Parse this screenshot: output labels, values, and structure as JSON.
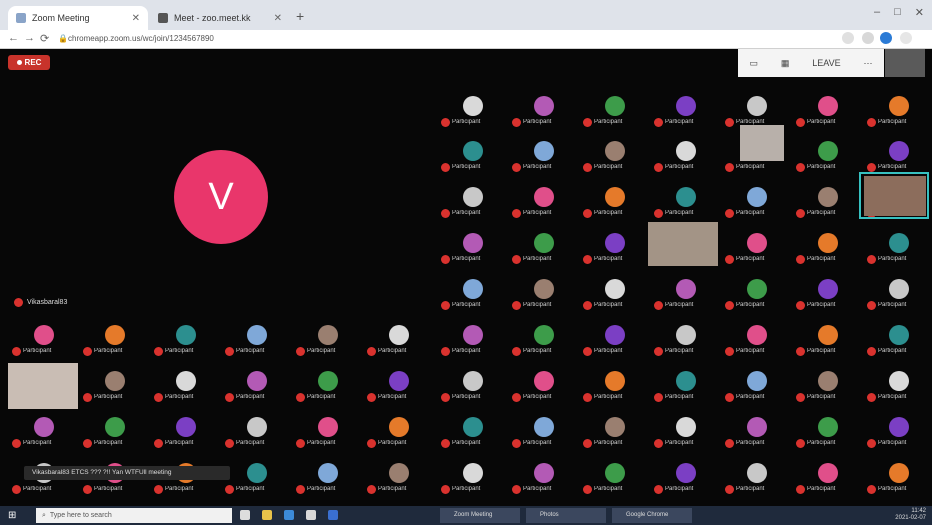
{
  "browser": {
    "tabs": [
      {
        "title": "Zoom Meeting",
        "active": true
      },
      {
        "title": "Meet - zoo.meet.kk",
        "active": false
      }
    ],
    "new_tab": "+",
    "url": "chromeapp.zoom.us/wc/join/1234567890",
    "back": "←",
    "forward": "→",
    "reload": "⟳",
    "window": {
      "minimize": "–",
      "maximize": "□",
      "close": "✕"
    }
  },
  "meeting": {
    "rec_label": "REC",
    "top_controls": {
      "view": "▭",
      "gallery": "▦",
      "leave": "LEAVE",
      "more": "⋯"
    },
    "active_speaker_initial": "V",
    "active_speaker_name": "Vikasbaral83",
    "chat_preview": "Vikasbaral83 ETCS ??? ?!! Yan WTFUll meeting",
    "participant_name": "Participant"
  },
  "taskbar": {
    "search_placeholder": "Type here to search",
    "apps": [
      "Zoom Meeting",
      "Photos",
      "Google Chrome"
    ],
    "time": "11:42",
    "date": "2021-02-07"
  },
  "colors": {
    "speaker": "#e9366b",
    "mic": "#d9322e",
    "highlight": "#37c1c1"
  }
}
